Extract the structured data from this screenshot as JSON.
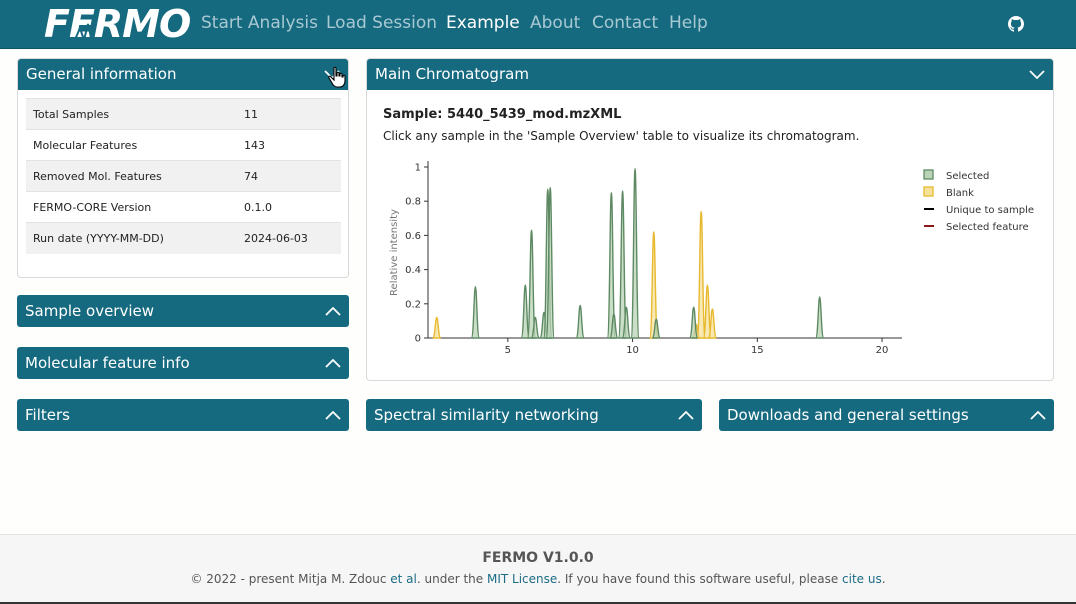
{
  "nav": {
    "brand": "FERMO",
    "links": [
      "Start Analysis",
      "Load Session",
      "Example",
      "About",
      "Contact",
      "Help"
    ],
    "active": "Example",
    "github_icon": "github-icon"
  },
  "general_info": {
    "title": "General information",
    "rows": [
      {
        "label": "Total Samples",
        "value": "11"
      },
      {
        "label": "Molecular Features",
        "value": "143"
      },
      {
        "label": "Removed Mol. Features",
        "value": "74"
      },
      {
        "label": "FERMO-CORE Version",
        "value": "0.1.0"
      },
      {
        "label": "Run date (YYYY-MM-DD)",
        "value": "2024-06-03"
      }
    ]
  },
  "panels": {
    "sample_overview": "Sample overview",
    "molecular_feature_info": "Molecular feature info",
    "filters": "Filters",
    "spectral_networking": "Spectral similarity networking",
    "downloads": "Downloads and general settings"
  },
  "chromatogram": {
    "title": "Main Chromatogram",
    "sample_label": "Sample: 5440_5439_mod.mzXML",
    "hint": "Click any sample in the 'Sample Overview' table to visualize its chromatogram."
  },
  "chart_data": {
    "type": "area",
    "xlabel": "",
    "ylabel": "Relative intensity",
    "xlim": [
      1.8,
      20.8
    ],
    "ylim": [
      0,
      1
    ],
    "x_ticks": [
      5,
      10,
      15,
      20
    ],
    "y_ticks": [
      0,
      0.2,
      0.4,
      0.6,
      0.8,
      1
    ],
    "y_tick_labels": [
      "0",
      "0.2",
      "0.4",
      "0.6",
      "0.8",
      "1"
    ],
    "legend": [
      {
        "name": "Selected",
        "color": "#5e8a63",
        "fill": "#b8d3b5",
        "kind": "box"
      },
      {
        "name": "Blank",
        "color": "#e8b92e",
        "fill": "#f6e19a",
        "kind": "box"
      },
      {
        "name": "Unique to sample",
        "color": "#000000",
        "kind": "line"
      },
      {
        "name": "Selected feature",
        "color": "#8b1a1a",
        "kind": "line"
      }
    ],
    "legend_position": "right",
    "series": [
      {
        "name": "Selected",
        "peaks": [
          {
            "rt": 3.7,
            "h": 0.3
          },
          {
            "rt": 5.7,
            "h": 0.31
          },
          {
            "rt": 5.95,
            "h": 0.63
          },
          {
            "rt": 6.1,
            "h": 0.12
          },
          {
            "rt": 6.45,
            "h": 0.15
          },
          {
            "rt": 6.6,
            "h": 0.87
          },
          {
            "rt": 6.7,
            "h": 0.88
          },
          {
            "rt": 7.9,
            "h": 0.19
          },
          {
            "rt": 9.15,
            "h": 0.85
          },
          {
            "rt": 9.25,
            "h": 0.14
          },
          {
            "rt": 9.6,
            "h": 0.86
          },
          {
            "rt": 9.75,
            "h": 0.18
          },
          {
            "rt": 10.1,
            "h": 0.99
          },
          {
            "rt": 10.95,
            "h": 0.11
          },
          {
            "rt": 12.45,
            "h": 0.18
          },
          {
            "rt": 17.5,
            "h": 0.24
          }
        ]
      },
      {
        "name": "Blank",
        "peaks": [
          {
            "rt": 2.15,
            "h": 0.12
          },
          {
            "rt": 10.85,
            "h": 0.62
          },
          {
            "rt": 12.55,
            "h": 0.08
          },
          {
            "rt": 12.75,
            "h": 0.74
          },
          {
            "rt": 13.0,
            "h": 0.31
          },
          {
            "rt": 13.2,
            "h": 0.17
          }
        ]
      }
    ]
  }
}
